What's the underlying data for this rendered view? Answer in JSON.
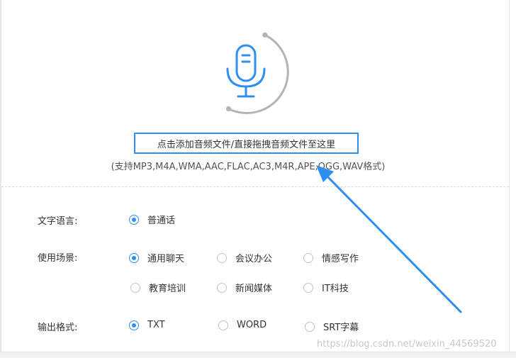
{
  "upload": {
    "prompt": "点击添加音频文件/直接拖拽音频文件至这里",
    "formats": "(支持MP3,M4A,WMA,AAC,FLAC,AC3,M4R,APE,OGG,WAV格式)"
  },
  "options": {
    "language": {
      "label": "文字语言:",
      "choices": [
        {
          "text": "普通话",
          "selected": true
        }
      ]
    },
    "scene": {
      "label": "使用场景:",
      "choices": [
        {
          "text": "通用聊天",
          "selected": true
        },
        {
          "text": "会议办公",
          "selected": false
        },
        {
          "text": "情感写作",
          "selected": false
        },
        {
          "text": "教育培训",
          "selected": false
        },
        {
          "text": "新闻媒体",
          "selected": false
        },
        {
          "text": "IT科技",
          "selected": false
        }
      ]
    },
    "output": {
      "label": "输出格式:",
      "choices": [
        {
          "text": "TXT",
          "selected": true
        },
        {
          "text": "WORD",
          "selected": false
        },
        {
          "text": "SRT字幕",
          "selected": false
        }
      ]
    }
  },
  "watermark": "https://blog.csdn.net/weixin_44569520",
  "colors": {
    "accent": "#2e8ff0",
    "ring": "#b4b4b4",
    "annotation": "#2e8ff0"
  },
  "icons": {
    "microphone": "microphone-icon"
  }
}
